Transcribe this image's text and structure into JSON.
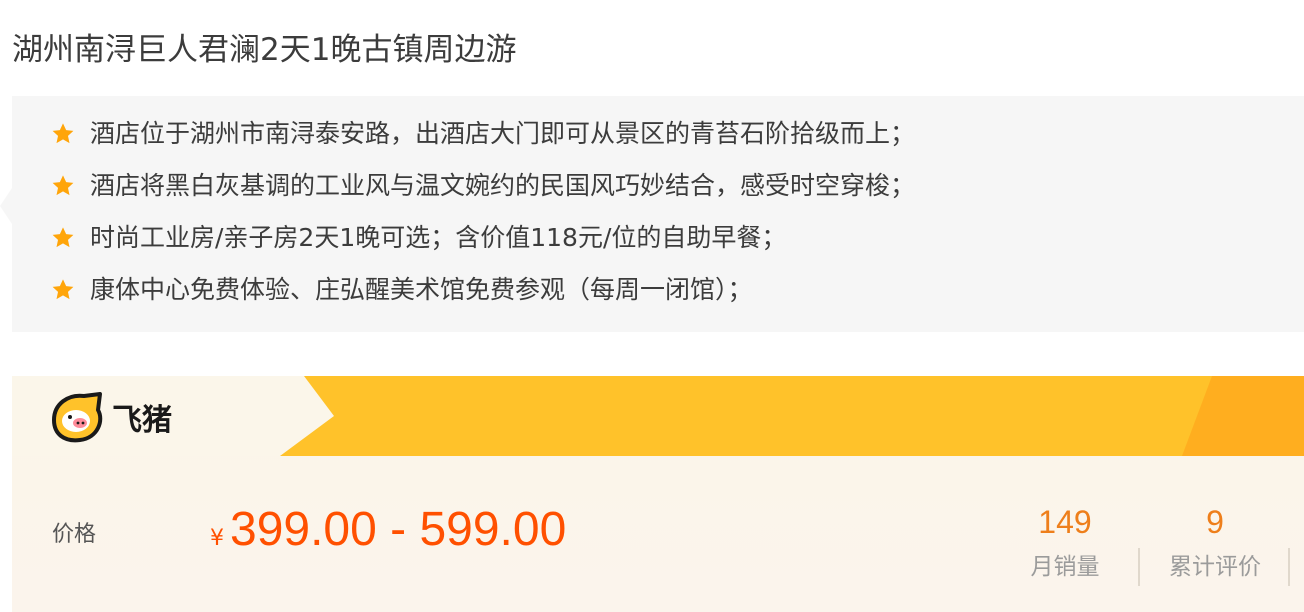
{
  "product": {
    "title": "湖州南浔巨人君澜2天1晚古镇周边游"
  },
  "highlights": [
    {
      "text": "酒店位于湖州市南浔泰安路，出酒店大门即可从景区的青苔石阶拾级而上；"
    },
    {
      "text": "酒店将黑白灰基调的工业风与温文婉约的民国风巧妙结合，感受时空穿梭；"
    },
    {
      "text": "时尚工业房/亲子房2天1晚可选；含价值118元/位的自助早餐；"
    },
    {
      "text": "康体中心免费体验、庄弘醒美术馆免费参观（每周一闭馆）；"
    }
  ],
  "promo": {
    "brand": "飞猪",
    "price_label": "价格",
    "currency": "¥",
    "price_range": "399.00 - 599.00",
    "monthly_sales": "149",
    "monthly_sales_label": "月销量",
    "total_reviews": "9",
    "total_reviews_label": "累计评价"
  },
  "colors": {
    "price": "#ff5000",
    "stat_number": "#ee7f1b",
    "banner_yellow": "#ffc22a",
    "banner_orange": "#ffae1f",
    "star": "#ffa50a"
  },
  "icons": {
    "highlight_bullet": "star-icon",
    "brand_logo": "fliggy-logo"
  }
}
